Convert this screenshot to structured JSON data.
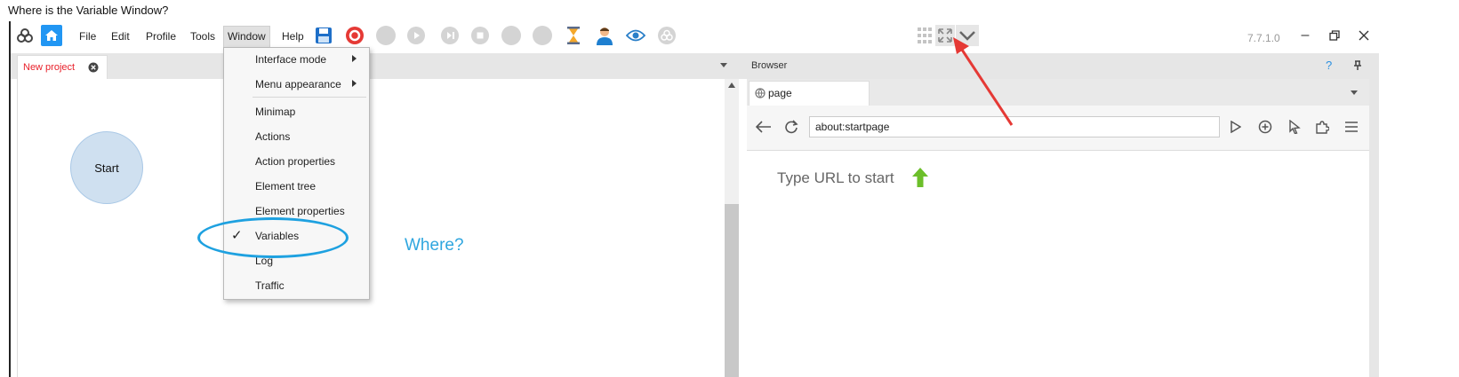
{
  "question": "Where is the Variable Window?",
  "toolbar": {
    "menus": [
      "File",
      "Edit",
      "Profile",
      "Tools",
      "Window",
      "Help"
    ],
    "version": "7.7.1.0"
  },
  "project_tab": {
    "label": "New project"
  },
  "canvas": {
    "start_node": "Start",
    "annotation": "Where?"
  },
  "window_menu": {
    "items": [
      "Interface mode",
      "Menu appearance",
      "Minimap",
      "Actions",
      "Action properties",
      "Element tree",
      "Element properties",
      "Variables",
      "Log",
      "Traffic"
    ],
    "checked_item": "Variables",
    "checkmark": "✓"
  },
  "browser": {
    "title": "Browser",
    "help": "?",
    "tab_label": "page",
    "url": "about:startpage",
    "start_text": "Type URL to start"
  },
  "colors": {
    "accent": "#1e88e5",
    "annotation_blue": "#1ea1e0",
    "arrow_red": "#e53935",
    "project_tab_red": "#e8202a"
  }
}
